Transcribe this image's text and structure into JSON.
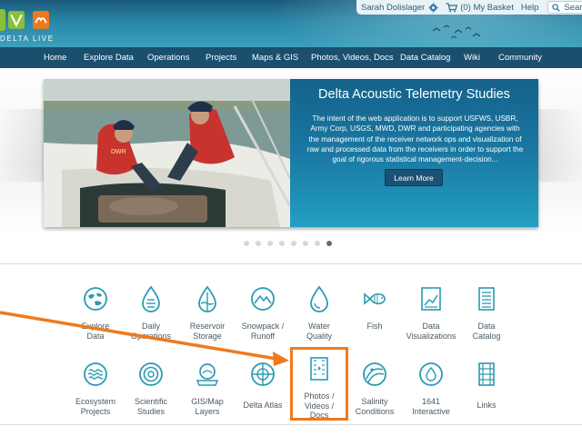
{
  "brand": {
    "logo_text": "DELTA LIVE",
    "accent": "#ef7a1c",
    "nav_bg": "#1a4f6e",
    "icon_color": "#2a9bb2"
  },
  "utility": {
    "user": "Sarah Dolislager",
    "basket": "(0) My Basket",
    "help": "Help",
    "search": "Search"
  },
  "nav": [
    {
      "label": "Home"
    },
    {
      "label": "Explore Data"
    },
    {
      "label": "Operations"
    },
    {
      "label": "Projects"
    },
    {
      "label": "Maps & GIS"
    },
    {
      "label": "Photos, Videos, Docs"
    },
    {
      "label": "Data Catalog"
    },
    {
      "label": "Wiki"
    },
    {
      "label": "Community"
    }
  ],
  "hero": {
    "title": "Delta Acoustic Telemetry Studies",
    "description": "The intent of the web application is to support USFWS, USBR, Army Corp, USGS, MWD, DWR and participating agencies with the management of the receiver network ops and visualization of raw and processed data from the receivers in order to support the goal of rigorous statistical management-decision...",
    "button": "Learn More",
    "photo_text": "DWR",
    "slides_total": 8,
    "slide_active": 8
  },
  "tiles_row1": [
    {
      "label": "Explore\nData",
      "icon": "globe-icon"
    },
    {
      "label": "Daily\nOperations",
      "icon": "water-drop-icon"
    },
    {
      "label": "Reservoir\nStorage",
      "icon": "reservoir-drop-icon"
    },
    {
      "label": "Snowpack /\nRunoff",
      "icon": "mountain-icon"
    },
    {
      "label": "Water\nQuality",
      "icon": "quality-drop-icon"
    },
    {
      "label": "Fish",
      "icon": "fish-icon"
    },
    {
      "label": "Data\nVisualizations",
      "icon": "chart-icon"
    },
    {
      "label": "Data\nCatalog",
      "icon": "catalog-icon"
    }
  ],
  "tiles_row2": [
    {
      "label": "Ecosystem\nProjects",
      "icon": "waves-icon"
    },
    {
      "label": "Scientific\nStudies",
      "icon": "target-icon"
    },
    {
      "label": "GIS/Map\nLayers",
      "icon": "map-layers-icon"
    },
    {
      "label": "Delta Atlas",
      "icon": "compass-icon"
    },
    {
      "label": "Photos /\nVideos /\nDocs",
      "icon": "media-icon"
    },
    {
      "label": "Salinity\nConditions",
      "icon": "salinity-icon"
    },
    {
      "label": "1641\nInteractive",
      "icon": "interactive-icon"
    },
    {
      "label": "Links",
      "icon": "links-icon"
    }
  ]
}
